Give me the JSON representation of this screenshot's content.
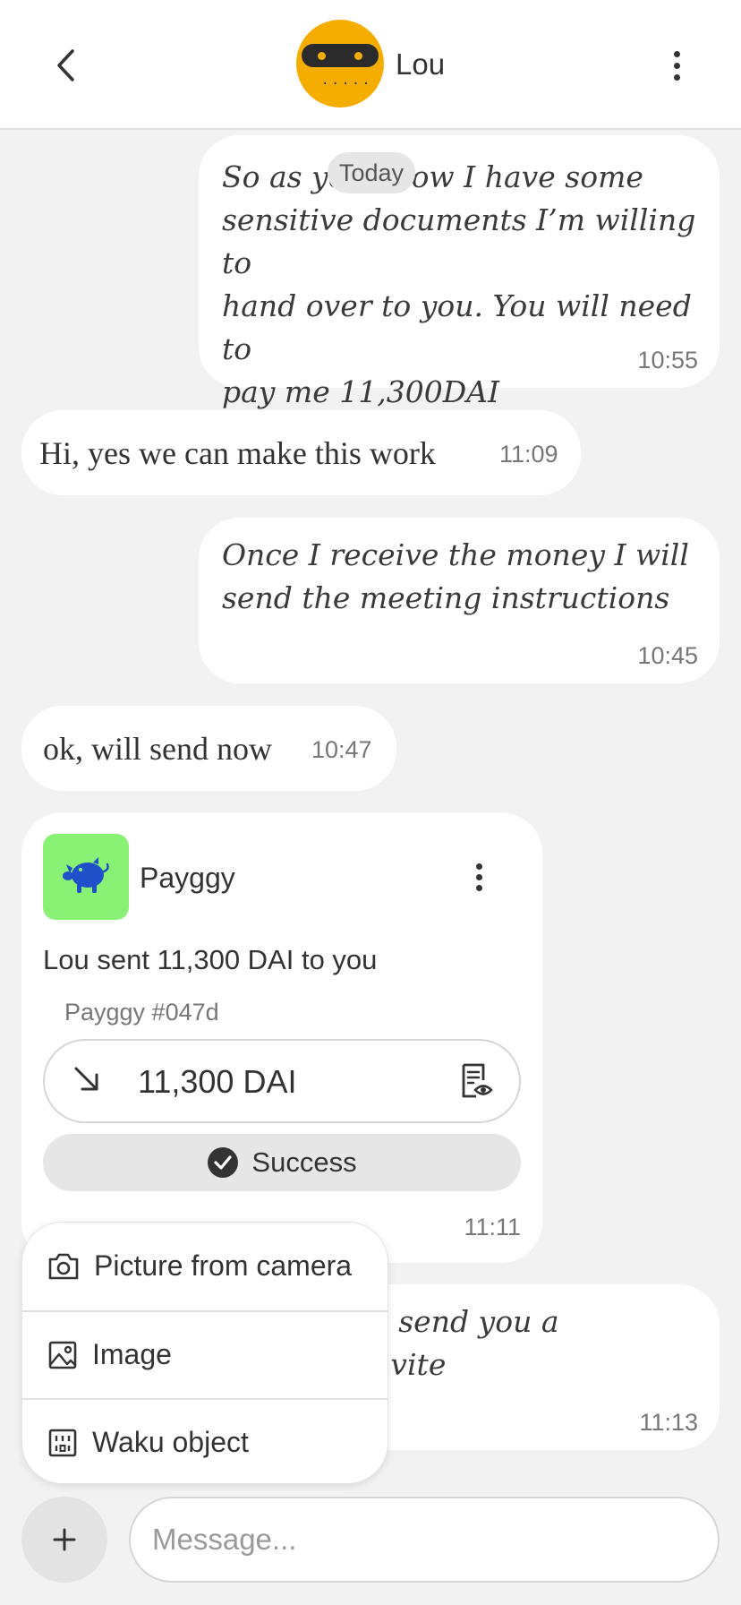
{
  "header": {
    "contact_name": "Lou",
    "back_icon": "chevron-left-icon",
    "menu_icon": "vertical-dots-icon",
    "avatar_color": "#f5ad00"
  },
  "date_separator": "Today",
  "messages": [
    {
      "direction": "outgoing",
      "text_lines": [
        "So as you know I have some",
        "sensitive documents I’m willing to",
        "hand over to you. You will need to",
        "pay me 11,300DAI"
      ],
      "time": "10:55"
    },
    {
      "direction": "incoming",
      "text": "Hi, yes we can make this work",
      "time": "11:09"
    },
    {
      "direction": "outgoing",
      "text_lines": [
        "Once I receive the money I will",
        "send the meeting instructions"
      ],
      "time": "10:45"
    },
    {
      "direction": "incoming",
      "text": "ok, will send now",
      "time": "10:47"
    },
    {
      "direction": "outgoing",
      "text_lines": [
        "Thanks, I’ll send you a",
        "calendar invite"
      ],
      "time": "11:13"
    }
  ],
  "payment_card": {
    "app_name": "Payggy",
    "app_icon": "piggy-bank-icon",
    "app_icon_bg": "#89f174",
    "description": "Lou sent 11,300 DAI to you",
    "tx_label": "Payggy #047d",
    "amount": "11,300 DAI",
    "status": "Success",
    "time": "11:11"
  },
  "attach_menu": {
    "items": [
      {
        "label": "Picture from camera",
        "icon": "camera-icon"
      },
      {
        "label": "Image",
        "icon": "image-icon"
      },
      {
        "label": "Waku object",
        "icon": "waku-object-icon"
      }
    ]
  },
  "composer": {
    "placeholder": "Message...",
    "add_icon": "plus-icon"
  }
}
